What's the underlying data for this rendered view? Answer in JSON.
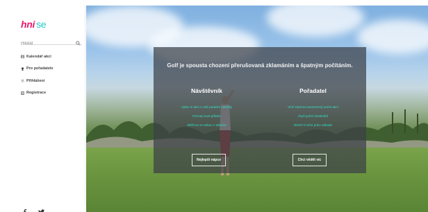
{
  "sidebar": {
    "logo": {
      "part1": "hni",
      "part2": "se"
    },
    "search": {
      "placeholder": "Hledat"
    },
    "items": [
      {
        "label": "Kalendář akcí",
        "icon": "calendar-icon"
      },
      {
        "label": "Pro pořadatele",
        "icon": "trophy-icon"
      },
      {
        "label": "Přihlášení",
        "icon": "login-icon"
      },
      {
        "label": "Registrace",
        "icon": "registration-icon"
      }
    ],
    "social": [
      {
        "icon": "facebook-icon"
      },
      {
        "icon": "twitter-icon"
      }
    ]
  },
  "hero": {
    "headline": "Golf je spousta chození přerušovaná zklamáním a špatným počítáním.",
    "visitor": {
      "title": "Návštěvník",
      "items": [
        "Vyber si akci z celé parádní nabídky",
        "Poznej nové přátele",
        "Měřit se se sebou v tabulce"
      ],
      "button": "Nejlepší nápce"
    },
    "organizer": {
      "title": "Pořadatel",
      "items": [
        "Vlož zdarma neomezený počet akcí",
        "Zvyš počet účastníků",
        "Nechť ti ruční práci odbude"
      ],
      "button": "Chci vědět víc"
    }
  },
  "colors": {
    "brand_pink": "#e6196d",
    "brand_teal": "#26c9c9",
    "link_teal": "#2fe0c8"
  }
}
